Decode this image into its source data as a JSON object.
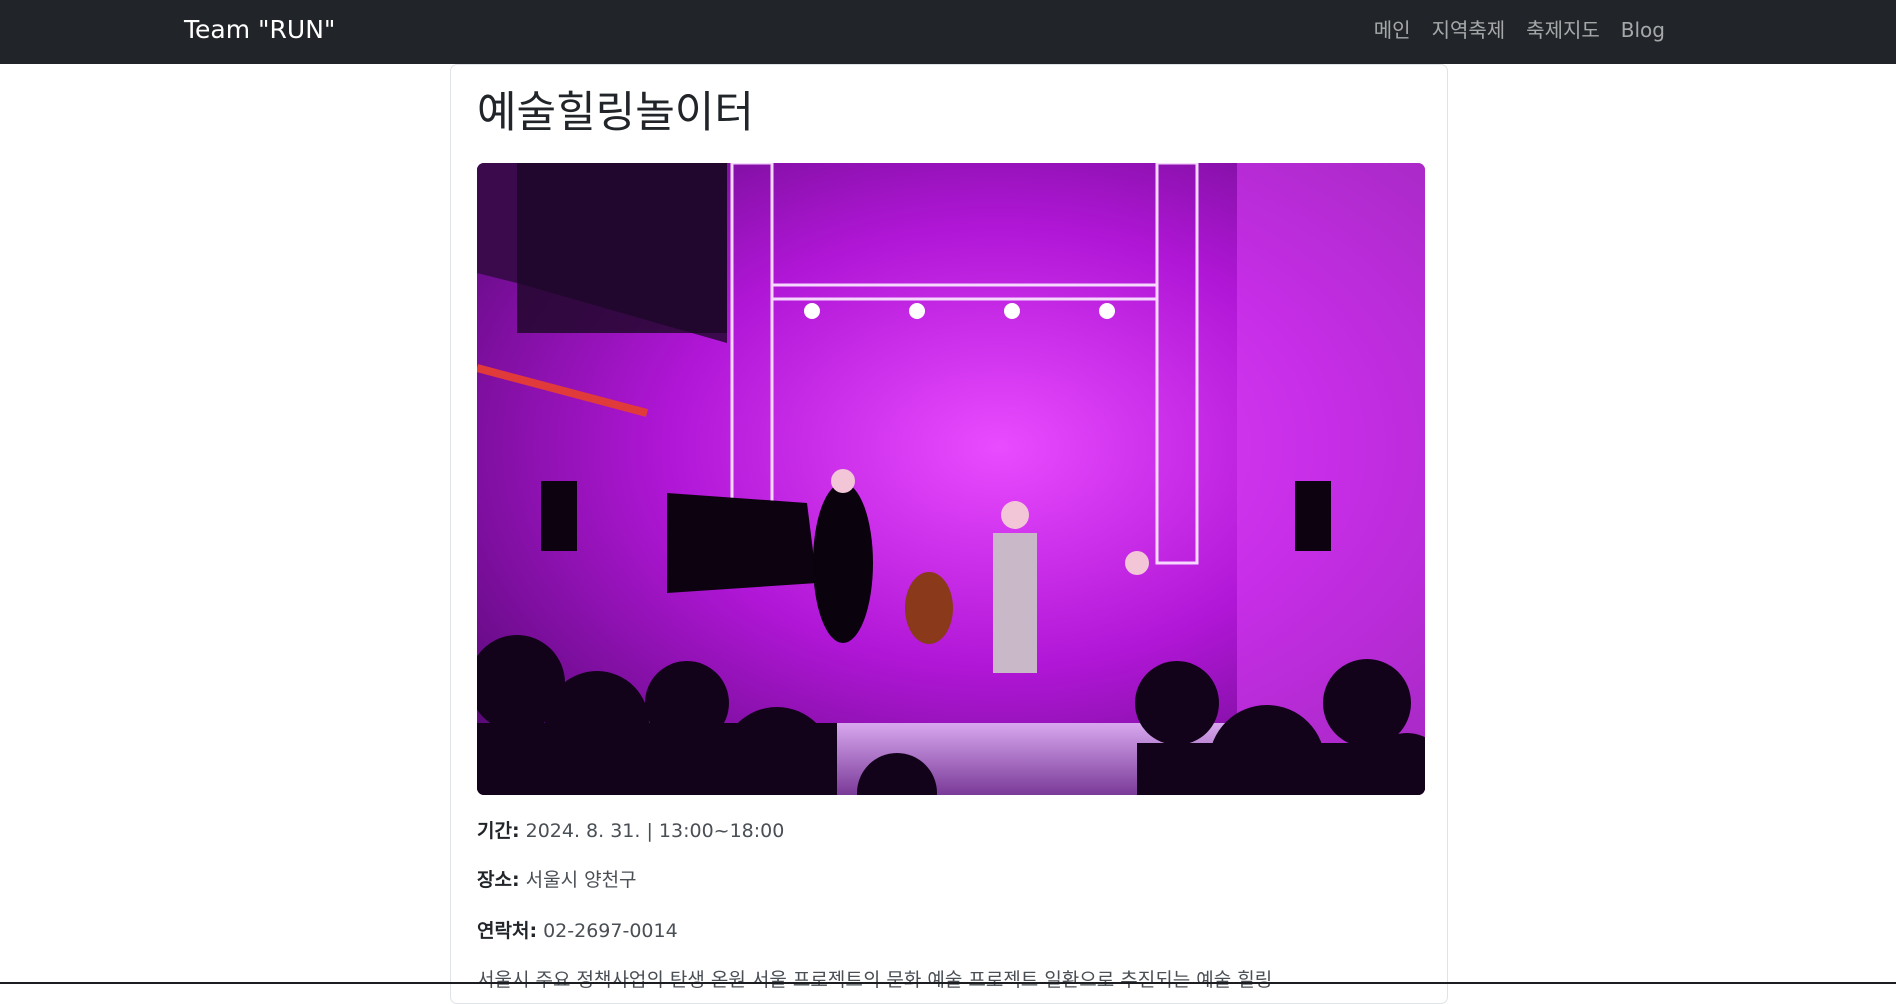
{
  "navbar": {
    "brand": "Team \"RUN\"",
    "links": [
      {
        "label": "메인"
      },
      {
        "label": "지역축제"
      },
      {
        "label": "축제지도"
      },
      {
        "label": "Blog"
      }
    ]
  },
  "festival": {
    "title": "예술힐링놀이터",
    "period_label": "기간:",
    "period_value": "2024. 8. 31. | 13:00~18:00",
    "location_label": "장소:",
    "location_value": "서울시 양천구",
    "contact_label": "연락처:",
    "contact_value": "02-2697-0014",
    "description": "서울시 주요 정책사업의 탄생 온원 서울 프로젝트의 문화 예술 프로젝트 일환으로 추진되는 예술 힐링"
  },
  "colors": {
    "navbar_bg": "#212529",
    "stage_magenta": "#c21fe0"
  }
}
